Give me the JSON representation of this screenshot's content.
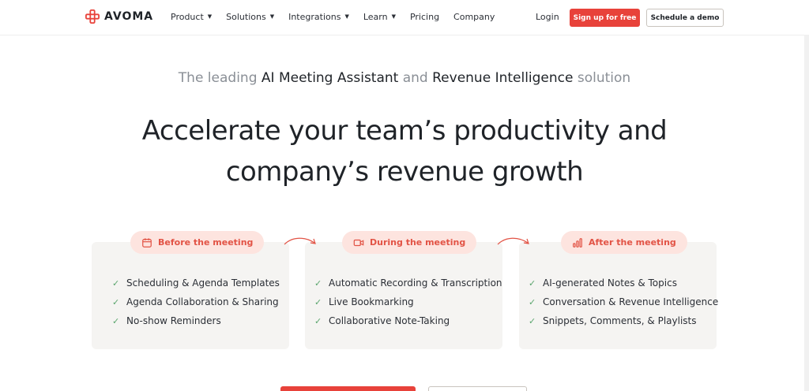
{
  "nav": {
    "logo_text": "AVOMA",
    "menu": [
      {
        "label": "Product",
        "dropdown": true
      },
      {
        "label": "Solutions",
        "dropdown": true
      },
      {
        "label": "Integrations",
        "dropdown": true
      },
      {
        "label": "Learn",
        "dropdown": true
      },
      {
        "label": "Pricing",
        "dropdown": false
      },
      {
        "label": "Company",
        "dropdown": false
      }
    ],
    "login": "Login",
    "signup": "Sign up for free",
    "demo": "Schedule a demo"
  },
  "hero": {
    "kicker_1": "The leading ",
    "kicker_2": "AI Meeting Assistant",
    "kicker_3": " and ",
    "kicker_4": "Revenue Intelligence",
    "kicker_5": " solution",
    "headline_1": "Accelerate your team’s productivity and",
    "headline_2": "company’s revenue growth"
  },
  "stages": [
    {
      "label": "Before the meeting",
      "icon": "calendar-icon",
      "items": [
        "Scheduling & Agenda Templates",
        "Agenda Collaboration & Sharing",
        "No-show Reminders"
      ]
    },
    {
      "label": "During the meeting",
      "icon": "video-camera-icon",
      "items": [
        "Automatic Recording & Transcription",
        "Live Bookmarking",
        "Collaborative Note-Taking"
      ]
    },
    {
      "label": "After the meeting",
      "icon": "bar-chart-icon",
      "items": [
        "AI-generated Notes & Topics",
        "Conversation & Revenue Intelligence",
        "Snippets, Comments, & Playlists"
      ]
    }
  ],
  "colors": {
    "accent": "#e8423a",
    "pill_bg": "#fde4df",
    "card_bg": "#f5f4f2",
    "check": "#5aa56d"
  }
}
